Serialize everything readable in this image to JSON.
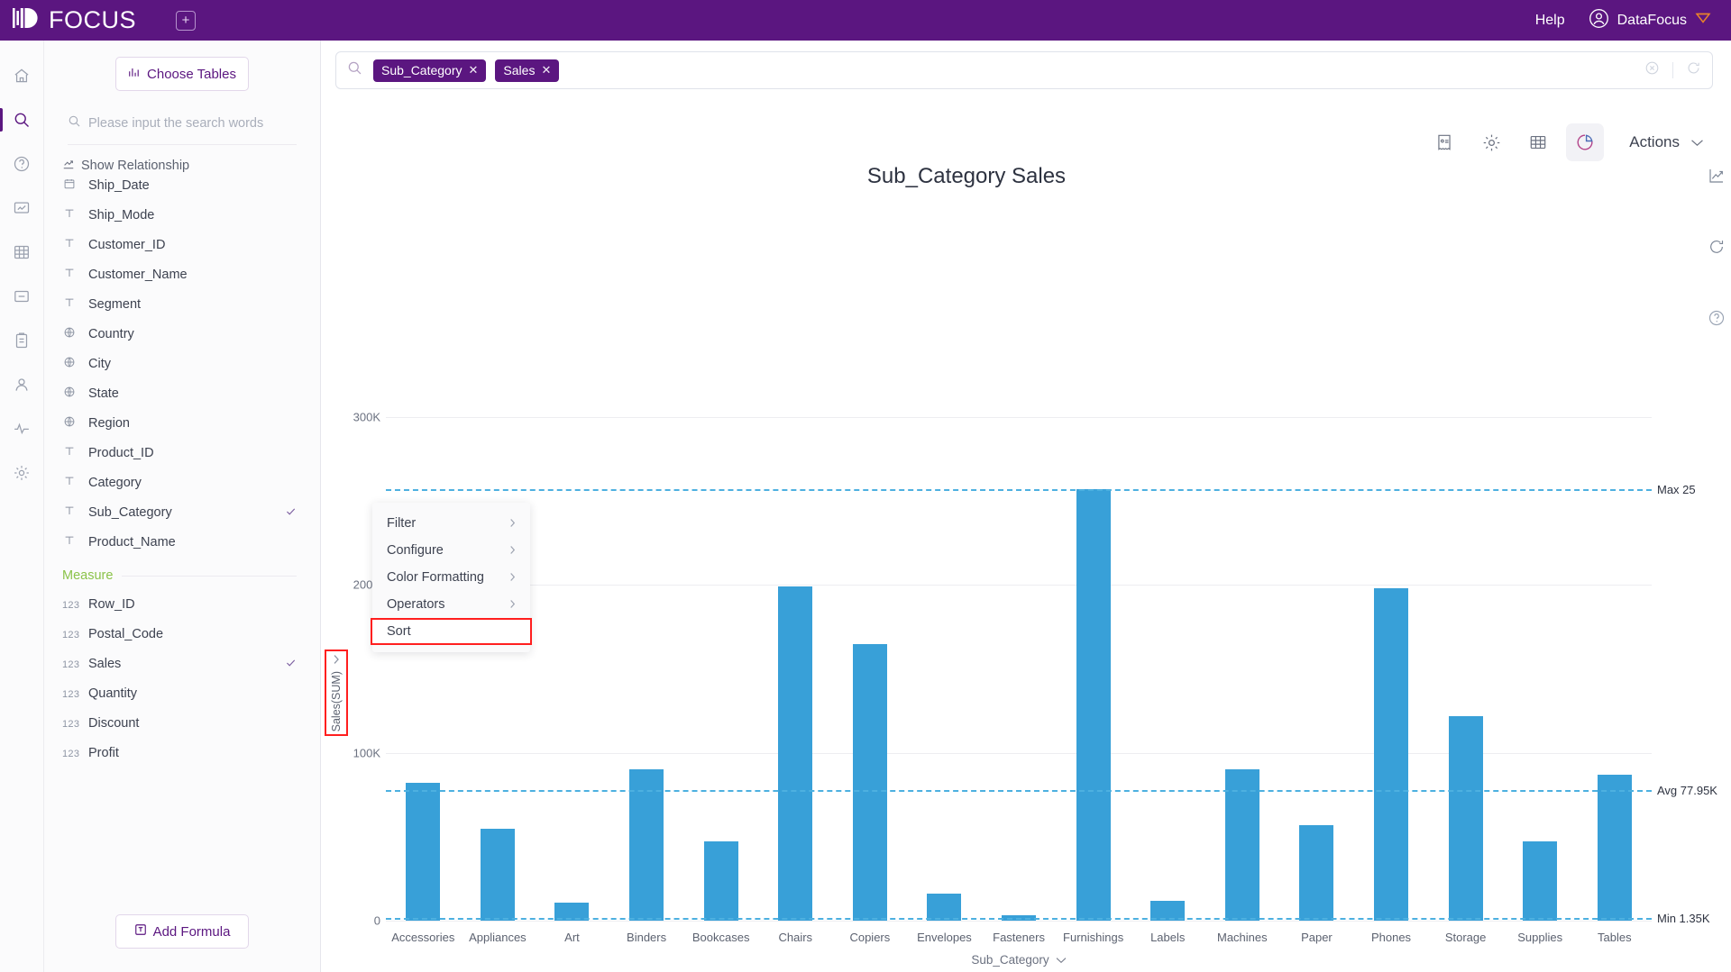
{
  "app": {
    "brand": "FOCUS",
    "add_tab_icon": "plus-square-icon",
    "help_label": "Help",
    "account_name": "DataFocus",
    "account_icon": "user-circle-icon",
    "account_badge_icon": "diamond-badge-icon",
    "brand_color": "#5b1680",
    "accent_color": "#38a0d8"
  },
  "rail": {
    "items": [
      {
        "name": "home",
        "icon": "home-icon",
        "active": false
      },
      {
        "name": "search",
        "icon": "search-icon",
        "active": true
      },
      {
        "name": "help",
        "icon": "question-circle-icon",
        "active": false
      },
      {
        "name": "dashboard",
        "icon": "presentation-icon",
        "active": false
      },
      {
        "name": "tables",
        "icon": "table-grid-icon",
        "active": false
      },
      {
        "name": "collapse",
        "icon": "minus-square-icon",
        "active": false
      },
      {
        "name": "tasks",
        "icon": "clipboard-icon",
        "active": false
      },
      {
        "name": "users",
        "icon": "user-icon",
        "active": false
      },
      {
        "name": "monitor",
        "icon": "pulse-icon",
        "active": false
      },
      {
        "name": "settings",
        "icon": "gear-icon",
        "active": false
      }
    ]
  },
  "panel": {
    "choose_tables_label": "Choose Tables",
    "choose_tables_icon": "table-chart-icon",
    "search_placeholder": "Please input the search words",
    "search_value": "",
    "search_icon": "search-icon",
    "show_relationship_label": "Show Relationship",
    "show_relationship_icon": "link-icon",
    "measure_group_label": "Measure",
    "add_formula_label": "Add Formula",
    "add_formula_icon": "formula-icon",
    "attributes": [
      {
        "label": "Ship_Date",
        "type": "date",
        "icon": "calendar-icon",
        "selected": false,
        "clipped": true
      },
      {
        "label": "Ship_Mode",
        "type": "text",
        "icon": "text-icon",
        "selected": false
      },
      {
        "label": "Customer_ID",
        "type": "text",
        "icon": "text-icon",
        "selected": false
      },
      {
        "label": "Customer_Name",
        "type": "text",
        "icon": "text-icon",
        "selected": false
      },
      {
        "label": "Segment",
        "type": "text",
        "icon": "text-icon",
        "selected": false
      },
      {
        "label": "Country",
        "type": "geo",
        "icon": "globe-icon",
        "selected": false
      },
      {
        "label": "City",
        "type": "geo",
        "icon": "globe-icon",
        "selected": false
      },
      {
        "label": "State",
        "type": "geo",
        "icon": "globe-icon",
        "selected": false
      },
      {
        "label": "Region",
        "type": "geo",
        "icon": "globe-icon",
        "selected": false
      },
      {
        "label": "Product_ID",
        "type": "text",
        "icon": "text-icon",
        "selected": false
      },
      {
        "label": "Category",
        "type": "text",
        "icon": "text-icon",
        "selected": false
      },
      {
        "label": "Sub_Category",
        "type": "text",
        "icon": "text-icon",
        "selected": true
      },
      {
        "label": "Product_Name",
        "type": "text",
        "icon": "text-icon",
        "selected": false
      }
    ],
    "measures": [
      {
        "label": "Row_ID",
        "type": "number",
        "icon": "123-icon",
        "selected": false
      },
      {
        "label": "Postal_Code",
        "type": "number",
        "icon": "123-icon",
        "selected": false
      },
      {
        "label": "Sales",
        "type": "number",
        "icon": "123-icon",
        "selected": true
      },
      {
        "label": "Quantity",
        "type": "number",
        "icon": "123-icon",
        "selected": false
      },
      {
        "label": "Discount",
        "type": "number",
        "icon": "123-icon",
        "selected": false
      },
      {
        "label": "Profit",
        "type": "number",
        "icon": "123-icon",
        "selected": false
      }
    ]
  },
  "search": {
    "icon": "search-icon",
    "chips": [
      {
        "label": "Sub_Category",
        "remove_icon": "close-icon"
      },
      {
        "label": "Sales",
        "remove_icon": "close-icon"
      }
    ],
    "clear_icon": "clear-circle-icon",
    "refresh_icon": "refresh-icon"
  },
  "toolbar": {
    "buttons": [
      {
        "name": "answer-config",
        "icon": "receipt-icon",
        "active": false
      },
      {
        "name": "chart-settings",
        "icon": "gear-icon",
        "active": false
      },
      {
        "name": "table-view",
        "icon": "table-grid-icon",
        "active": false
      },
      {
        "name": "chart-view",
        "icon": "pie-chart-icon",
        "active": true
      }
    ],
    "actions_label": "Actions",
    "actions_chevron_icon": "chevron-down-icon"
  },
  "float_tools": [
    {
      "name": "trend-chart",
      "icon": "line-chart-icon"
    },
    {
      "name": "reload-chart",
      "icon": "refresh-icon"
    },
    {
      "name": "chart-help",
      "icon": "question-circle-icon"
    }
  ],
  "context_menu": {
    "items": [
      {
        "label": "Filter",
        "has_submenu": true,
        "highlighted": false
      },
      {
        "label": "Configure",
        "has_submenu": true,
        "highlighted": false
      },
      {
        "label": "Color Formatting",
        "has_submenu": true,
        "highlighted": false
      },
      {
        "label": "Operators",
        "has_submenu": true,
        "highlighted": false
      },
      {
        "label": "Sort",
        "has_submenu": false,
        "highlighted": true
      }
    ],
    "submenu_icon": "chevron-right-icon"
  },
  "chart_data": {
    "type": "bar",
    "title": "Sub_Category Sales",
    "xlabel": "Sub_Category",
    "ylabel": "Sales(SUM)",
    "ylim": [
      0,
      300000
    ],
    "yticks": [
      0,
      100000,
      200000,
      300000
    ],
    "ytick_labels": [
      "0",
      "100K",
      "200K",
      "300K"
    ],
    "grid": true,
    "legend": "none",
    "bar_color": "#38a0d8",
    "categories": [
      "Accessories",
      "Appliances",
      "Art",
      "Binders",
      "Bookcases",
      "Chairs",
      "Copiers",
      "Envelopes",
      "Fasteners",
      "Furnishings",
      "Labels",
      "Machines",
      "Paper",
      "Phones",
      "Storage",
      "Supplies",
      "Tables"
    ],
    "values": [
      82000,
      55000,
      11000,
      90000,
      47000,
      199000,
      165000,
      16000,
      3000,
      257000,
      12000,
      90000,
      57000,
      198000,
      122000,
      47000,
      87000
    ],
    "reference_lines": [
      {
        "name": "max",
        "label": "Max 25",
        "label_full": "Max 25",
        "value": 257000,
        "style": "dashed",
        "color": "#4db0e0",
        "clipped": true
      },
      {
        "name": "avg",
        "label": "Avg 77.95K",
        "value": 77950,
        "style": "dashed",
        "color": "#4db0e0"
      },
      {
        "name": "min",
        "label": "Min 1.35K",
        "value": 1350,
        "style": "dashed",
        "color": "#4db0e0"
      }
    ],
    "xaxis_chevron_icon": "chevron-down-icon"
  }
}
